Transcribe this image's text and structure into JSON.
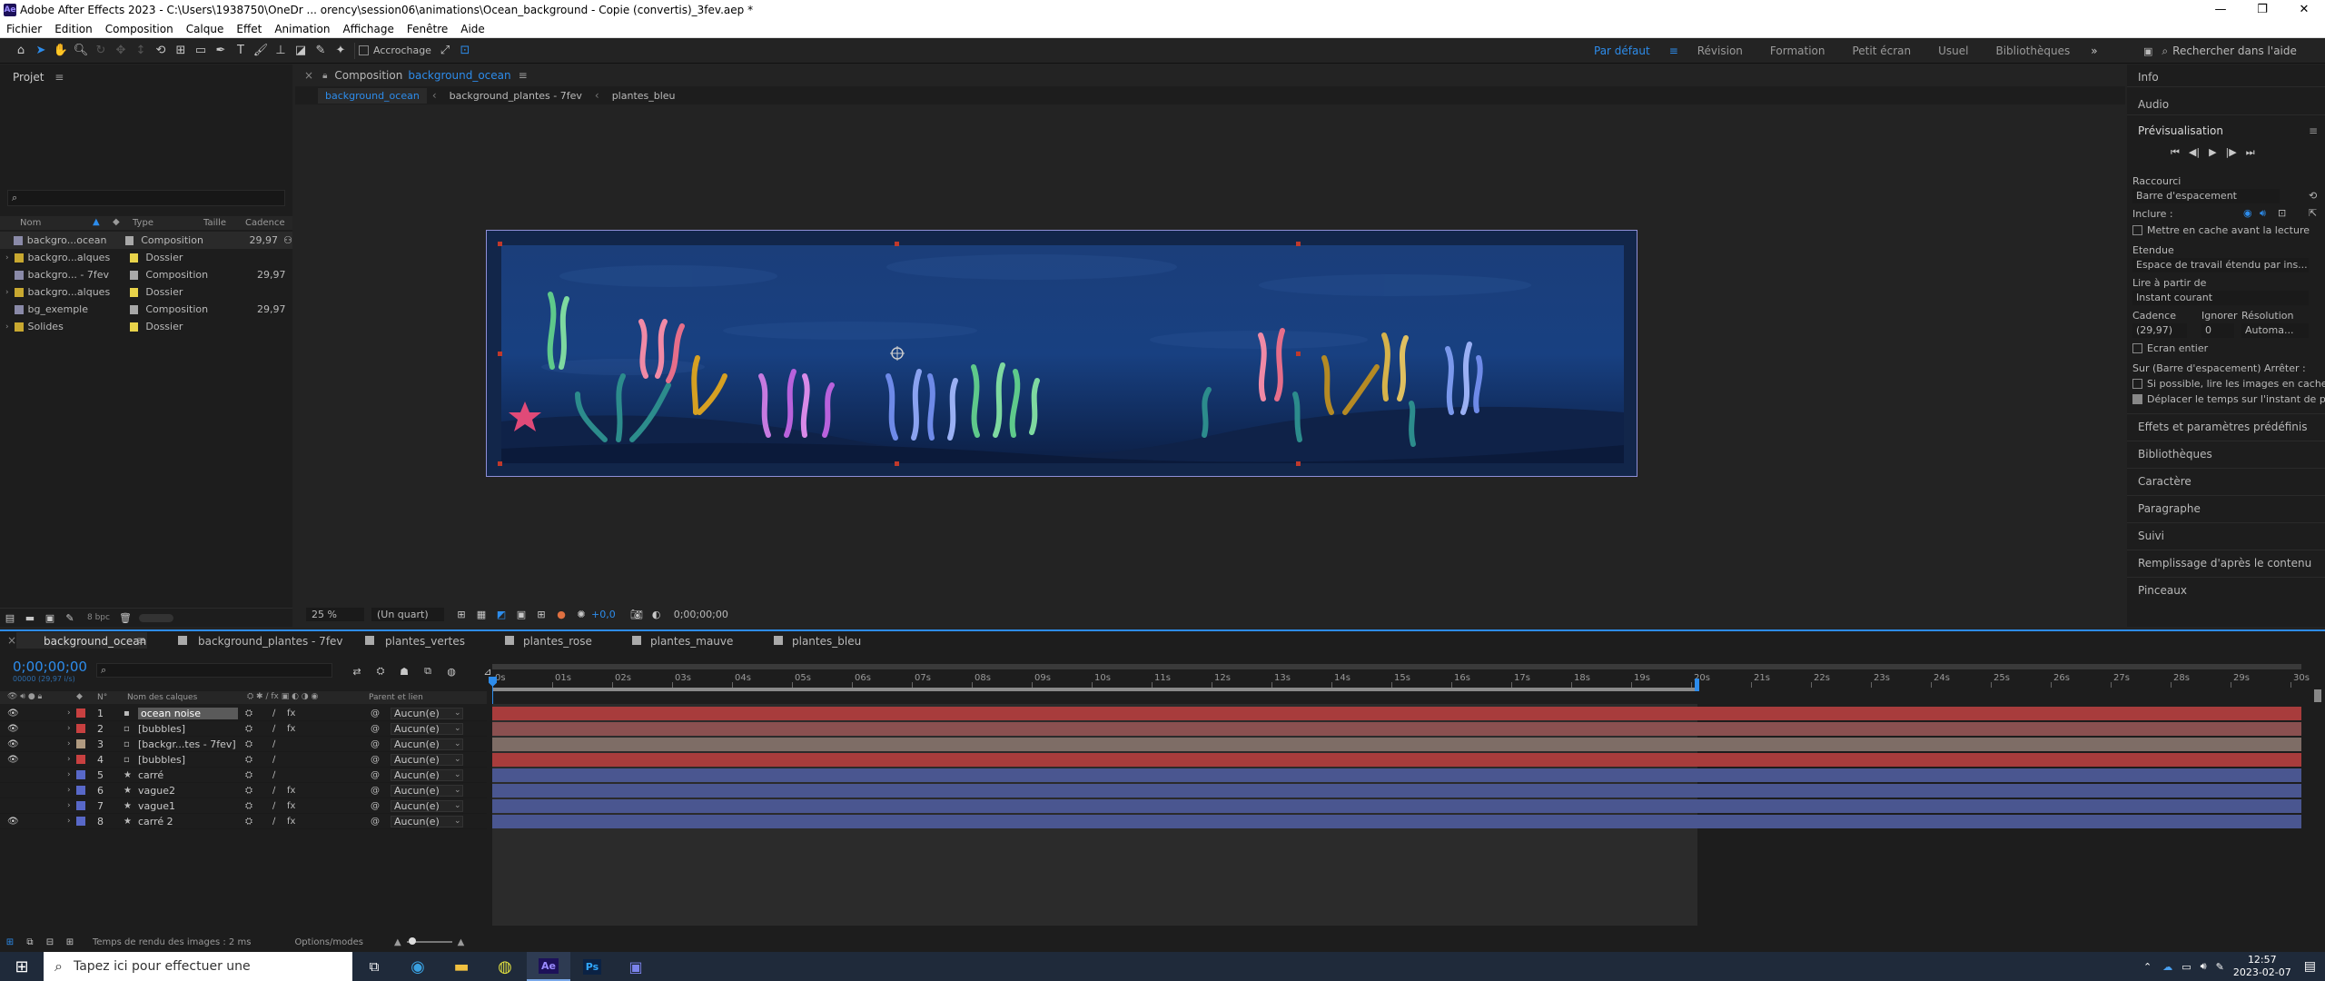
{
  "window": {
    "title": "Adobe After Effects 2023 - C:\\Users\\1938750\\OneDr ... orency\\session06\\animations\\Ocean_background - Copie (convertis)_3fev.aep *",
    "logo": "Ae"
  },
  "menu": [
    "Fichier",
    "Edition",
    "Composition",
    "Calque",
    "Effet",
    "Animation",
    "Affichage",
    "Fenêtre",
    "Aide"
  ],
  "toolbar": {
    "snapping_label": "Accrochage"
  },
  "workspaces": [
    "Par défaut",
    "Révision",
    "Formation",
    "Petit écran",
    "Usuel",
    "Bibliothèques"
  ],
  "search_help": "Rechercher dans l'aide",
  "project": {
    "title": "Projet",
    "columns": [
      "Nom",
      "Type",
      "Taille",
      "Cadence"
    ],
    "items": [
      {
        "name": "backgro...ocean",
        "type": "Composition",
        "cadence": "29,97",
        "color": "#a8a8a8"
      },
      {
        "name": "backgro...alques",
        "type": "Dossier",
        "cadence": "",
        "color": "#e8d34a"
      },
      {
        "name": "backgro... - 7fev",
        "type": "Composition",
        "cadence": "29,97",
        "color": "#a8a8a8"
      },
      {
        "name": "backgro...alques",
        "type": "Dossier",
        "cadence": "",
        "color": "#e8d34a"
      },
      {
        "name": "bg_exemple",
        "type": "Composition",
        "cadence": "29,97",
        "color": "#a8a8a8"
      },
      {
        "name": "Solides",
        "type": "Dossier",
        "cadence": "",
        "color": "#e8d34a"
      }
    ],
    "bpc": "8 bpc"
  },
  "composition": {
    "panel_label": "Composition",
    "active_name": "background_ocean",
    "breadcrumbs": [
      "background_ocean",
      "background_plantes - 7fev",
      "plantes_bleu"
    ],
    "zoom": "25 %",
    "resolution": "(Un quart)",
    "exposure": "+0,0",
    "timecode": "0;00;00;00"
  },
  "right_panel": {
    "info": "Info",
    "audio": "Audio",
    "preview": "Prévisualisation",
    "shortcut_label": "Raccourci",
    "shortcut_value": "Barre d'espacement",
    "include_label": "Inclure :",
    "cache_label": "Mettre en cache avant la lecture",
    "range_label": "Etendue",
    "range_value": "Espace de travail étendu par ins...",
    "play_from_label": "Lire à partir de",
    "play_from_value": "Instant courant",
    "cadence_label": "Cadence",
    "ignore_label": "Ignorer",
    "resolution_label": "Résolution",
    "cadence_value": "(29,97)",
    "ignore_value": "0",
    "resolution_value": "Automa...",
    "fullscreen": "Ecran entier",
    "stop_label": "Sur (Barre d'espacement) Arrêter :",
    "stop_opt1": "Si possible, lire les images en cache",
    "stop_opt2": "Déplacer le temps sur l'instant de pré",
    "sections": [
      "Effets et paramètres prédéfinis",
      "Bibliothèques",
      "Caractère",
      "Paragraphe",
      "Suivi",
      "Remplissage d'après le contenu",
      "Pinceaux"
    ]
  },
  "timeline": {
    "tabs": [
      "background_ocean",
      "background_plantes - 7fev",
      "plantes_vertes",
      "plantes_rose",
      "plantes_mauve",
      "plantes_bleu"
    ],
    "timecode": "0;00;00;00",
    "timecode_sub": "00000 (29,97 i/s)",
    "col_num": "N°",
    "col_name": "Nom des calques",
    "col_parent": "Parent et lien",
    "ticks": [
      "0s",
      "01s",
      "02s",
      "03s",
      "04s",
      "05s",
      "06s",
      "07s",
      "08s",
      "09s",
      "10s",
      "11s",
      "12s",
      "13s",
      "14s",
      "15s",
      "16s",
      "17s",
      "18s",
      "19s",
      "20s",
      "21s",
      "22s",
      "23s",
      "24s",
      "25s",
      "26s",
      "27s",
      "28s",
      "29s",
      "30s"
    ],
    "work_area_end_s": 20,
    "layers": [
      {
        "num": "1",
        "name": "ocean noise",
        "color": "#c84040",
        "parent": "Aucun(e)",
        "bar": "#a83c3c",
        "selected": true
      },
      {
        "num": "2",
        "name": "[bubbles]",
        "color": "#c84040",
        "parent": "Aucun(e)",
        "bar": "#8a5050"
      },
      {
        "num": "3",
        "name": "[backgr...tes - 7fev]",
        "color": "#b09a80",
        "parent": "Aucun(e)",
        "bar": "#7e6d66"
      },
      {
        "num": "4",
        "name": "[bubbles]",
        "color": "#c84040",
        "parent": "Aucun(e)",
        "bar": "#a83c3c"
      },
      {
        "num": "5",
        "name": "carré",
        "color": "#5868c8",
        "parent": "Aucun(e)",
        "bar": "#4a5690"
      },
      {
        "num": "6",
        "name": "vague2",
        "color": "#5868c8",
        "parent": "Aucun(e)",
        "bar": "#4a5690"
      },
      {
        "num": "7",
        "name": "vague1",
        "color": "#5868c8",
        "parent": "Aucun(e)",
        "bar": "#4a5690"
      },
      {
        "num": "8",
        "name": "carré 2",
        "color": "#5868c8",
        "parent": "Aucun(e)",
        "bar": "#4a5690"
      }
    ],
    "render_time": "Temps de rendu des images : 2 ms",
    "options": "Options/modes"
  },
  "taskbar": {
    "search_placeholder": "Tapez ici pour effectuer une",
    "time": "12:57",
    "date": "2023-02-07"
  },
  "colors": {
    "accent": "#2d8ceb",
    "comp_bg": "#12306a"
  }
}
